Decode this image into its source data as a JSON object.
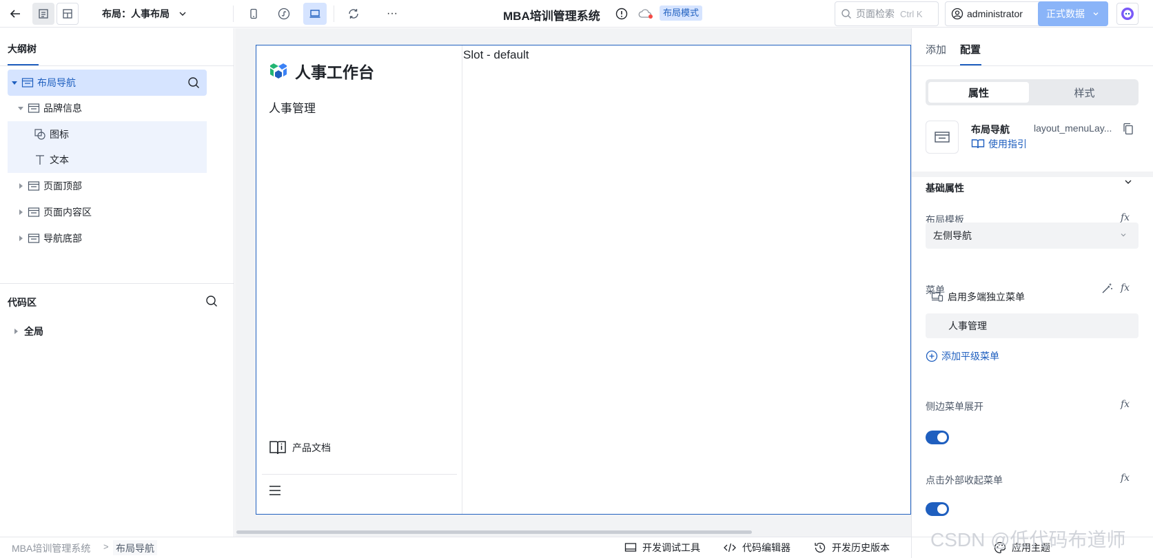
{
  "topbar": {
    "layout_label": "布局：人事布局",
    "app_title": "MBA培训管理系统",
    "mode_badge": "布局模式",
    "search_placeholder": "页面检索",
    "search_shortcut": "Ctrl K",
    "username": "administrator",
    "data_env": "正式数据",
    "more": "···"
  },
  "outline": {
    "tab_label": "大纲树",
    "nodes": [
      {
        "label": "布局导航"
      },
      {
        "label": "品牌信息"
      },
      {
        "label": "图标"
      },
      {
        "label": "文本"
      },
      {
        "label": "页面顶部"
      },
      {
        "label": "页面内容区"
      },
      {
        "label": "导航底部"
      }
    ],
    "code_section": "代码区",
    "global_node": "全局"
  },
  "preview": {
    "brand_name": "人事工作台",
    "menu_item": "人事管理",
    "doc_link": "产品文档",
    "slot_label": "Slot - default"
  },
  "right_panel": {
    "tabs": [
      "添加",
      "配置"
    ],
    "segments": [
      "属性",
      "样式"
    ],
    "component_name": "布局导航",
    "component_id": "layout_menuLay...",
    "guide_link": "使用指引",
    "section_title": "基础属性",
    "layout_template_label": "布局模板",
    "layout_template_value": "左侧导航",
    "menu_label": "菜单",
    "multi_menu": "启用多端独立菜单",
    "menu_entry": "人事管理",
    "add_menu": "添加平级菜单",
    "side_expand_label": "侧边菜单展开",
    "side_expand_on": true,
    "click_collapse_label": "点击外部收起菜单",
    "click_collapse_on": true,
    "fx": "fx"
  },
  "bottom": {
    "crumbs": [
      "MBA培训管理系统",
      "布局导航"
    ],
    "crumb_sep": ">",
    "dev_tools": "开发调试工具",
    "code_editor": "代码编辑器",
    "history": "开发历史版本",
    "theme": "应用主题"
  },
  "watermark": "CSDN @低代码布道师",
  "colors": {
    "accent": "#1f5fbf",
    "selected_row": "#d6e4ff",
    "sub_selected_row": "#eef3fd",
    "primary_light": "#8ab4f8"
  }
}
